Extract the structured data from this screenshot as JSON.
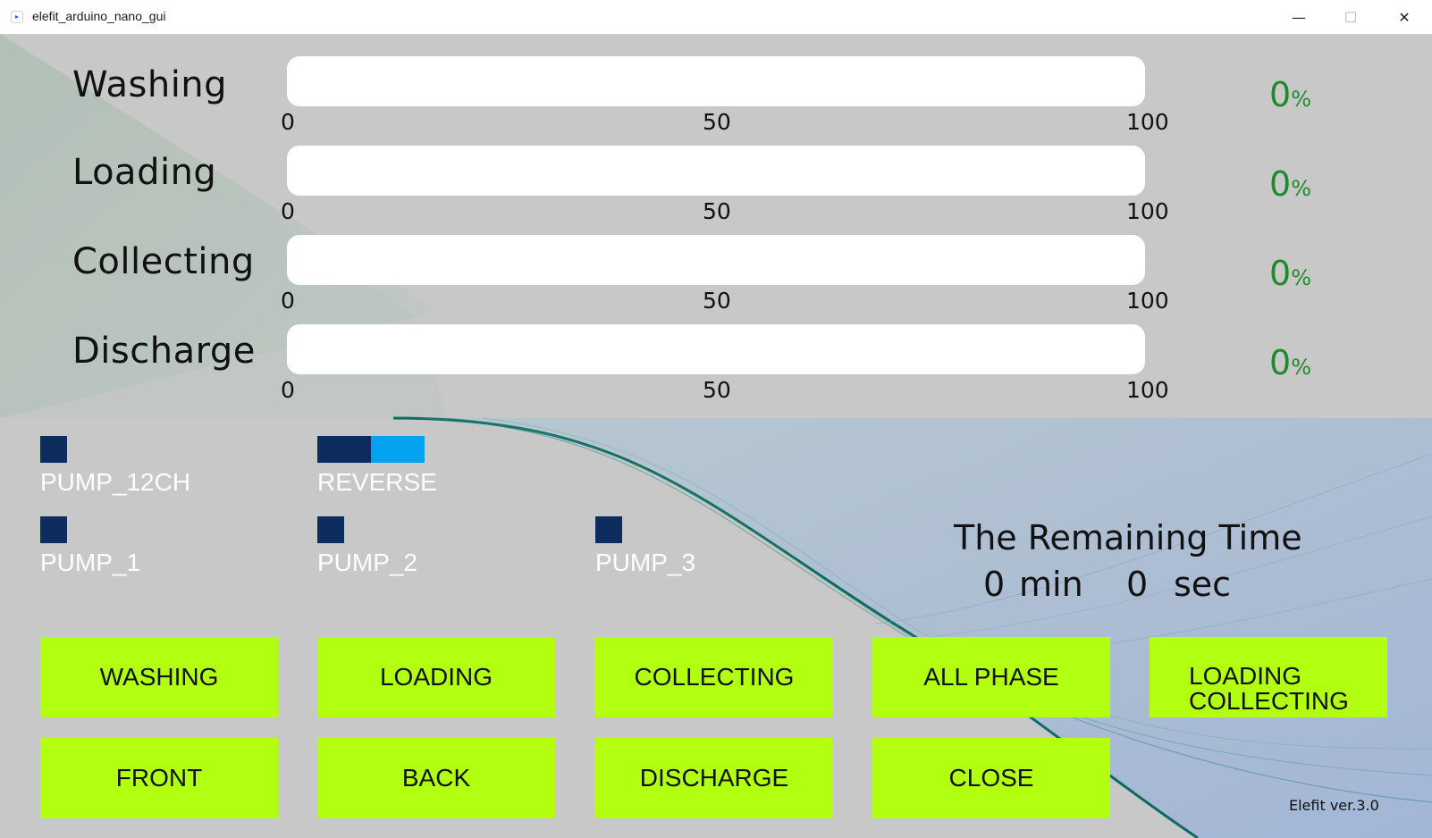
{
  "window": {
    "title": "elefit_arduino_nano_gui",
    "minimize_glyph": "—",
    "maximize_glyph": "☐",
    "close_glyph": "✕"
  },
  "progress": {
    "scale": {
      "min": "0",
      "mid": "50",
      "max": "100"
    },
    "percent_unit": "%",
    "phases": [
      {
        "label": "Washing",
        "value": 0,
        "percent_text": "0"
      },
      {
        "label": "Loading",
        "value": 0,
        "percent_text": "0"
      },
      {
        "label": "Collecting",
        "value": 0,
        "percent_text": "0"
      },
      {
        "label": "Discharge",
        "value": 0,
        "percent_text": "0"
      }
    ]
  },
  "pumps": {
    "pump_12ch": "PUMP_12CH",
    "reverse": "REVERSE",
    "pump_1": "PUMP_1",
    "pump_2": "PUMP_2",
    "pump_3": "PUMP_3"
  },
  "remaining": {
    "title": "The Remaining Time",
    "minutes": "0",
    "min_unit": "min",
    "seconds": "0",
    "sec_unit": "sec"
  },
  "buttons": {
    "washing": "WASHING",
    "loading": "LOADING",
    "collecting": "COLLECTING",
    "all_phase": "ALL PHASE",
    "loading_collecting_line1": "LOADING",
    "loading_collecting_line2": "COLLECTING",
    "front": "FRONT",
    "back": "BACK",
    "discharge": "DISCHARGE",
    "close": "CLOSE"
  },
  "version": "Elefit ver.3.0",
  "colors": {
    "button_bg": "#b3ff12",
    "indicator_off": "#0c2d5e",
    "reverse_on": "#05a2ef",
    "percent_text": "#1f8a2a"
  }
}
